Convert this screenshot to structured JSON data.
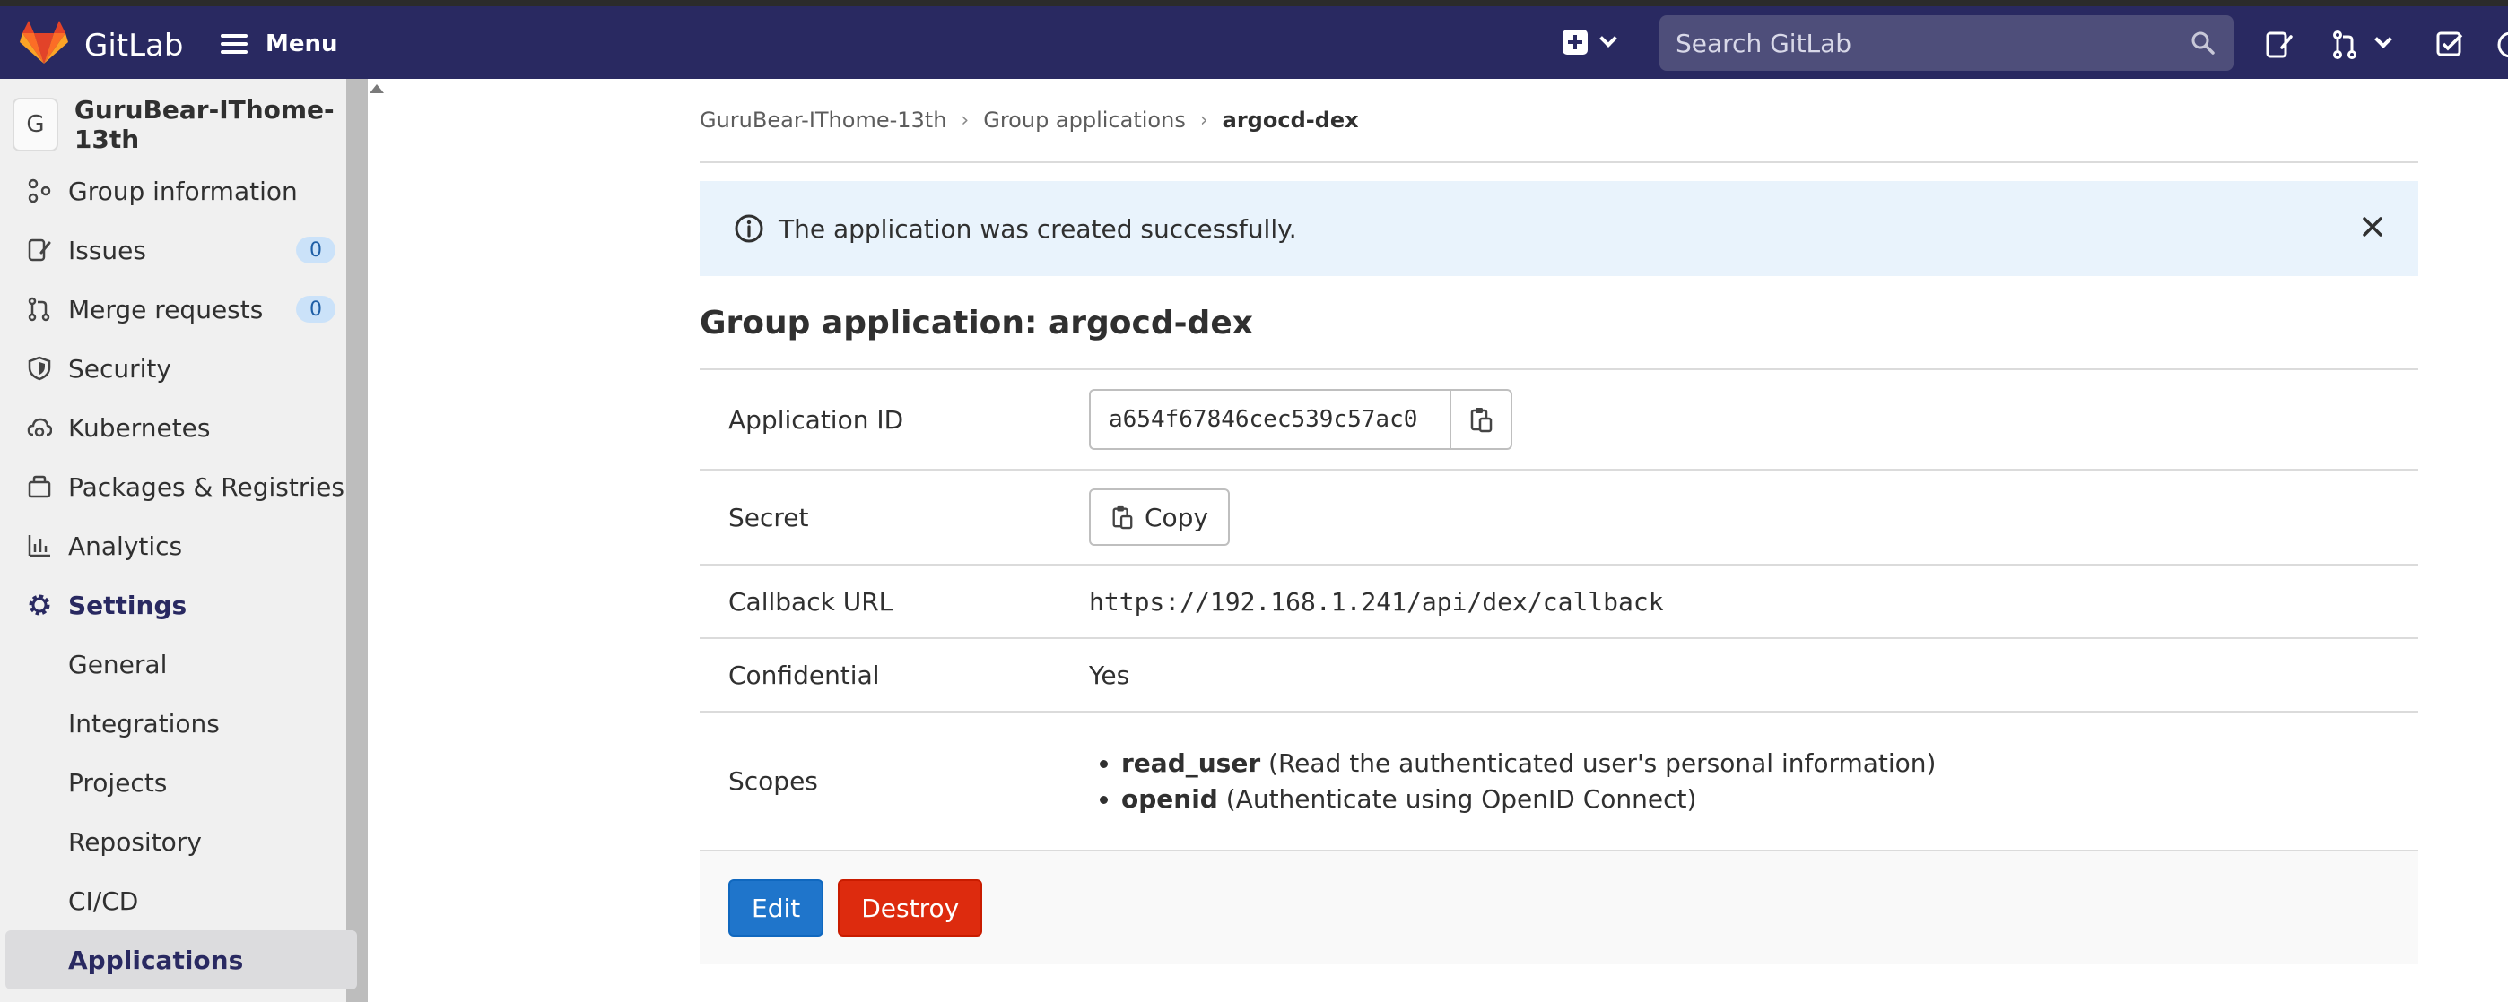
{
  "navbar": {
    "brand": "GitLab",
    "menu_label": "Menu",
    "search_placeholder": "Search GitLab"
  },
  "sidebar": {
    "group_avatar_letter": "G",
    "group_name": "GuruBear-IThome-13th",
    "items": [
      {
        "label": "Group information",
        "icon": "group-information-icon"
      },
      {
        "label": "Issues",
        "icon": "issues-icon",
        "count": "0"
      },
      {
        "label": "Merge requests",
        "icon": "merge-request-icon",
        "count": "0"
      },
      {
        "label": "Security",
        "icon": "shield-icon"
      },
      {
        "label": "Kubernetes",
        "icon": "kubernetes-icon"
      },
      {
        "label": "Packages & Registries",
        "icon": "package-icon"
      },
      {
        "label": "Analytics",
        "icon": "chart-icon"
      },
      {
        "label": "Settings",
        "icon": "gear-icon"
      }
    ],
    "settings_sub": [
      "General",
      "Integrations",
      "Projects",
      "Repository",
      "CI/CD",
      "Applications"
    ]
  },
  "breadcrumb": {
    "group": "GuruBear-IThome-13th",
    "section": "Group applications",
    "current": "argocd-dex"
  },
  "alert": {
    "message": "The application was created successfully."
  },
  "page_title": "Group application: argocd-dex",
  "details": {
    "app_id_label": "Application ID",
    "app_id_value": "a654f67846cec539c57ac0",
    "secret_label": "Secret",
    "secret_button": "Copy",
    "callback_label": "Callback URL",
    "callback_value": "https://192.168.1.241/api/dex/callback",
    "confidential_label": "Confidential",
    "confidential_value": "Yes",
    "scopes_label": "Scopes",
    "scopes": [
      {
        "name": "read_user",
        "desc": "(Read the authenticated user's personal information)"
      },
      {
        "name": "openid",
        "desc": "(Authenticate using OpenID Connect)"
      }
    ]
  },
  "actions": {
    "edit": "Edit",
    "destroy": "Destroy"
  },
  "colors": {
    "navbar": "#292961",
    "primary": "#1f75cb",
    "danger": "#dd2b0e",
    "alert_bg": "#e9f3fc"
  }
}
